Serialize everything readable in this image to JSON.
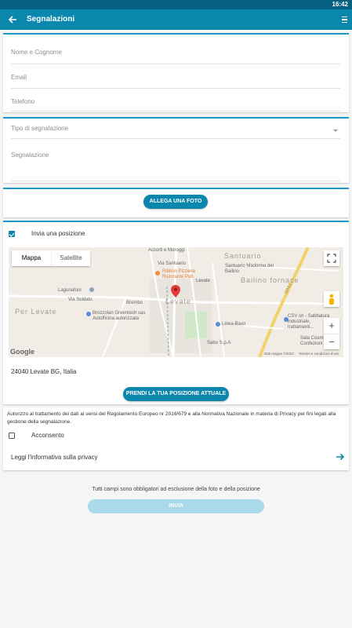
{
  "status_bar": {
    "time": "16:42"
  },
  "app_bar": {
    "title": "Segnalazioni"
  },
  "contact": {
    "name_placeholder": "Nome e Cognome",
    "email_placeholder": "Email",
    "phone_placeholder": "Telefono"
  },
  "report": {
    "type_placeholder": "Tipo di segnalazione",
    "text_placeholder": "Segnalazione"
  },
  "photo": {
    "button_label": "ALLEGA UNA FOTO"
  },
  "position": {
    "checkbox_label": "Invia una posizione",
    "checked": true,
    "address": "24040 Levate BG, Italia",
    "locate_button": "PRENDI LA TUA POSIZIONE ATTUALE"
  },
  "map": {
    "tab_map": "Mappa",
    "tab_satellite": "Satellite",
    "zoom_in": "+",
    "zoom_out": "−",
    "logo": "Google",
    "attribution": "Dati mappa ©2023",
    "terms": "Termini e condizioni d'uso",
    "place_labels": {
      "accorti": "Accorti e Moroggi",
      "ribbon": "Ribbon Pizzeria Ristorante Pub",
      "santuario": "Santuario",
      "santuario_madonna": "Santuario Madonna del Bailino",
      "bailino": "Bailino fornace",
      "lagunaluni": "Lagunafuni",
      "levate": "Levate",
      "per_levate": "Per Levate",
      "brembo": "Brembo",
      "brozzolan": "Brozzolan Greentech sas Autofficina autorizzata",
      "linea_bavo": "Linea-Bavo",
      "csv": "CSV srl - Sabbatura industriale, trattamenti...",
      "sala_cosmo": "Sala Cosme Confezioni",
      "sabo": "Sabo S.p.A",
      "sp42": "SP42",
      "via_soldato": "Via Soldato",
      "via_santuario": "Via Santuario",
      "levate_sud": "Levate"
    }
  },
  "privacy": {
    "text": "Autorizzo al trattamento dei dati ai sensi del Regolamento Europeo nr 2016/679 e alla Normativa Nazionale in materia di Privacy per fini legati alla gestione della segnalazione.",
    "consent_label": "Acconsento",
    "consent_checked": false,
    "link_label": "Leggi l'informativa sulla privacy"
  },
  "footer": {
    "note": "Tutti campi sono obbligatori ad esclusione della foto e della posizione",
    "submit_label": "INVIA"
  },
  "colors": {
    "primary": "#0b86ad",
    "status_bar": "#05607f",
    "submit_disabled": "#a9d9ea"
  }
}
